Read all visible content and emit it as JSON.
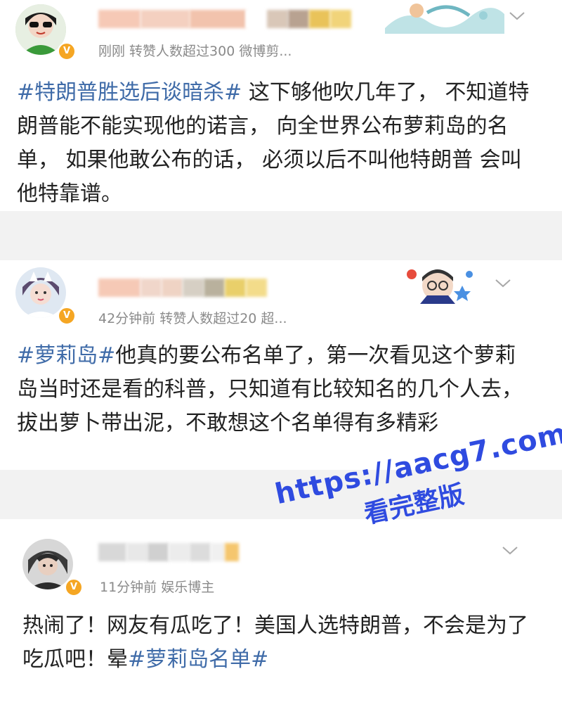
{
  "posts": [
    {
      "meta": "刚刚  转赞人数超过300  微博剪...",
      "tag": "#特朗普胜选后谈暗杀#",
      "text": " 这下够他吹几年了，  不知道特朗普能不能实现他的诺言，  向全世界公布萝莉岛的名单，  如果他敢公布的话，  必须以后不叫他特朗普 会叫他特靠谱。"
    },
    {
      "meta": "42分钟前  转赞人数超过20  超...",
      "tag": "#萝莉岛#",
      "text": "他真的要公布名单了，第一次看见这个萝莉岛当时还是看的科普，只知道有比较知名的几个人去，拔出萝卜带出泥，不敢想这个名单得有多精彩"
    },
    {
      "meta": "11分钟前  娱乐博主",
      "text": "热闹了！网友有瓜吃了！美国人选特朗普，不会是为了吃瓜吧！晕",
      "tag": "#萝莉岛名单#"
    }
  ],
  "watermark": {
    "url": "https://aacg7.com",
    "sub": "看完整版"
  },
  "colors": {
    "tag": "#3f6ba8",
    "meta": "#8a8a8a",
    "verified": "#f5a623",
    "watermark": "#2f4be0"
  }
}
